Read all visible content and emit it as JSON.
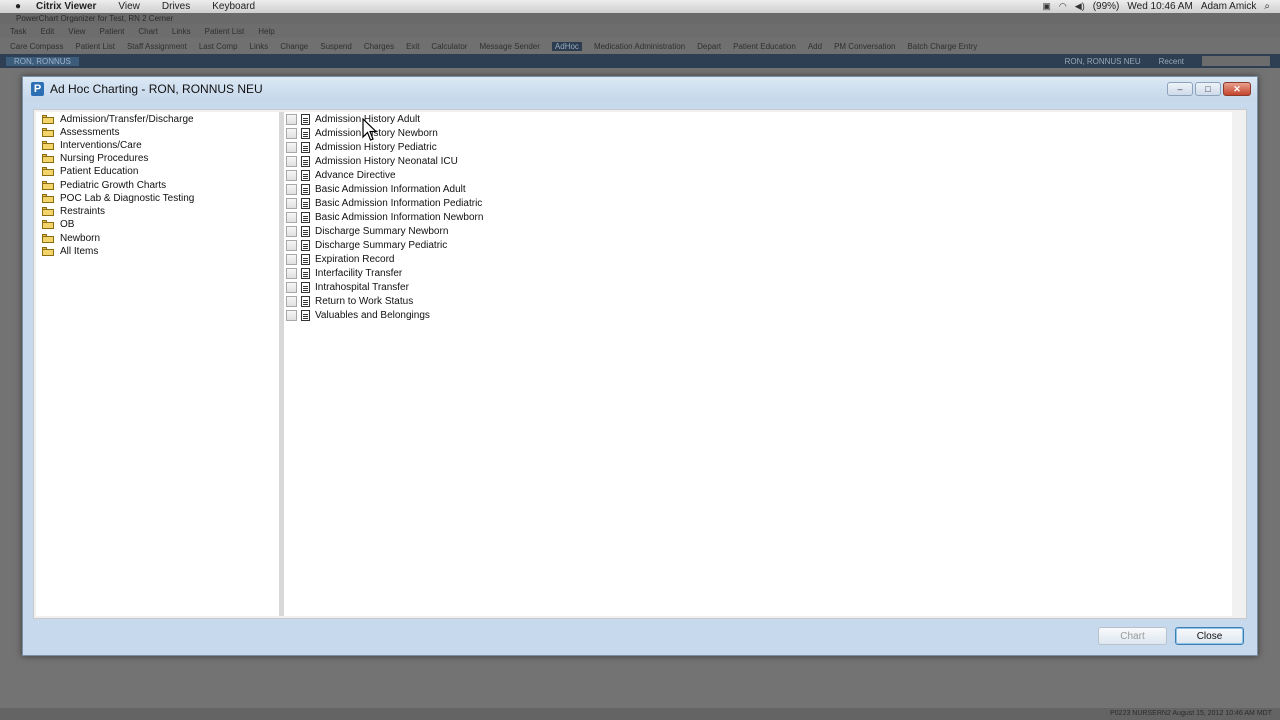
{
  "macbar": {
    "apple": "",
    "menus": [
      "Citrix Viewer",
      "View",
      "Drives",
      "Keyboard"
    ],
    "battery": "(99%)",
    "clock": "Wed 10:46 AM",
    "user": "Adam Amick"
  },
  "background": {
    "title": "PowerChart Organizer for Test, RN 2 Cerner",
    "menu": [
      "Task",
      "Edit",
      "View",
      "Patient",
      "Chart",
      "Links",
      "Patient List",
      "Help"
    ],
    "toolbar": [
      "Care Compass",
      "Patient List",
      "Staff Assignment",
      "Last Comp",
      "Links",
      "Change",
      "Suspend",
      "Charges",
      "Exit",
      "Calculator",
      "Message Sender",
      "AdHoc",
      "Medication Administration",
      "Depart",
      "Patient Education",
      "Add",
      "PM Conversation",
      "Batch Charge Entry"
    ],
    "patient_tab": "RON, RONNUS",
    "patient_right": "RON, RONNUS NEU",
    "recent": "Recent",
    "status": "P0223  NURSERN2  August 15, 2012  10:46 AM MDT"
  },
  "dialog": {
    "title": "Ad Hoc Charting - RON, RONNUS NEU",
    "app_icon": "P",
    "folders": [
      "Admission/Transfer/Discharge",
      "Assessments",
      "Interventions/Care",
      "Nursing Procedures",
      "Patient Education",
      "Pediatric Growth Charts",
      "POC Lab & Diagnostic Testing",
      "Restraints",
      "OB",
      "Newborn",
      "All Items"
    ],
    "forms": [
      "Admission History Adult",
      "Admission History Newborn",
      "Admission History Pediatric",
      "Admission History Neonatal ICU",
      "Advance Directive",
      "Basic Admission Information Adult",
      "Basic Admission Information Pediatric",
      "Basic Admission Information Newborn",
      "Discharge Summary Newborn",
      "Discharge Summary Pediatric",
      "Expiration Record",
      "Interfacility Transfer",
      "Intrahospital Transfer",
      "Return to Work Status",
      "Valuables and Belongings"
    ],
    "chart_button": "Chart",
    "close_button": "Close",
    "minimize_glyph": "–",
    "maximize_glyph": "□",
    "close_glyph": "✕"
  }
}
